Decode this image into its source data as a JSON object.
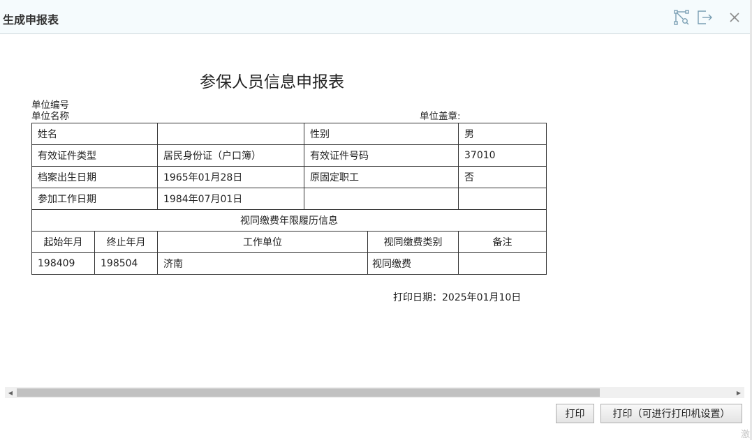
{
  "dialog": {
    "title": "生成申报表",
    "controls": [
      {
        "name": "maximize-icon",
        "icon": "select-resize-icon"
      },
      {
        "name": "exit-icon",
        "icon": "exit-arrow-icon"
      },
      {
        "name": "close-icon",
        "icon": "close-icon"
      }
    ]
  },
  "document": {
    "title": "参保人员信息申报表",
    "unit_code_label": "单位编号",
    "unit_name_label": "单位名称",
    "unit_seal_label": "单位盖章:",
    "rows": {
      "name_label": "姓名",
      "name_value": "",
      "gender_label": "性别",
      "gender_value": "男",
      "id_type_label": "有效证件类型",
      "id_type_value": "居民身份证（户口簿）",
      "id_number_label": "有效证件号码",
      "id_number_value": "37010",
      "birth_label": "档案出生日期",
      "birth_value": "1965年01月28日",
      "former_staff_label": "原固定职工",
      "former_staff_value": "否",
      "work_start_label": "参加工作日期",
      "work_start_value": "1984年07月01日"
    },
    "history_section_title": "视同缴费年限履历信息",
    "history_headers": [
      "起始年月",
      "终止年月",
      "工作单位",
      "视同缴费类别",
      "备注"
    ],
    "history_rows": [
      {
        "start": "198409",
        "end": "198504",
        "employer": "济南",
        "category": "视同缴费",
        "remark": ""
      }
    ],
    "print_date": "打印日期：2025年01月10日"
  },
  "footer": {
    "print_button": "打印",
    "print_settings_button": "打印（可进行打印机设置）"
  },
  "watermark": "激"
}
